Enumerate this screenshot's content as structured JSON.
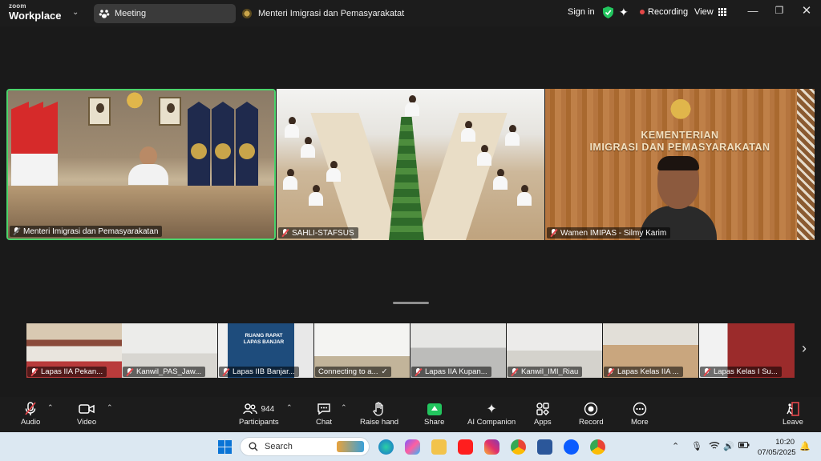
{
  "titlebar": {
    "brand_line1": "zoom",
    "brand_line2": "Workplace",
    "tab_meeting": "Meeting",
    "tab_window": "Menteri Imigrasi dan Pemasyarakatat",
    "signin": "Sign in",
    "recording": "Recording",
    "view": "View"
  },
  "main_tiles": [
    {
      "name": "Menteri Imigrasi dan Pemasyarakatan"
    },
    {
      "name": "SAHLI-STAFSUS"
    },
    {
      "name": "Wamen IMIPAS - Silmy Karim"
    }
  ],
  "tile3_wall_text": [
    "KEMENTERIAN",
    "IMIGRASI DAN PEMASYARAKATAN"
  ],
  "thumbnails": [
    {
      "name": "Lapas IIA Pekan...",
      "muted": true
    },
    {
      "name": "Kanwil_PAS_Jaw...",
      "muted": true
    },
    {
      "name": "Lapas IIB Banjar...",
      "muted": true
    },
    {
      "name": "Connecting to a...",
      "muted": false
    },
    {
      "name": "Lapas IIA Kupan...",
      "muted": true
    },
    {
      "name": "Kanwil_IMI_Riau",
      "muted": true
    },
    {
      "name": "Lapas Kelas IIA ...",
      "muted": true
    },
    {
      "name": "Lapas Kelas I Su...",
      "muted": true
    }
  ],
  "thumb3_wall_text": "RUANG RAPAT LAPAS BANJAR",
  "toolbar": {
    "audio": "Audio",
    "video": "Video",
    "participants_count": "944",
    "participants": "Participants",
    "chat": "Chat",
    "raise_hand": "Raise hand",
    "share": "Share",
    "ai_companion": "AI Companion",
    "apps": "Apps",
    "record": "Record",
    "more": "More",
    "leave": "Leave"
  },
  "taskbar": {
    "search_placeholder": "Search",
    "time": "10:20",
    "date": "07/05/2025"
  },
  "colors": {
    "active_speaker_border": "#4bd36b",
    "recording_dot": "#e54848",
    "share_green": "#22c55e",
    "mute_red": "#e5484d"
  }
}
